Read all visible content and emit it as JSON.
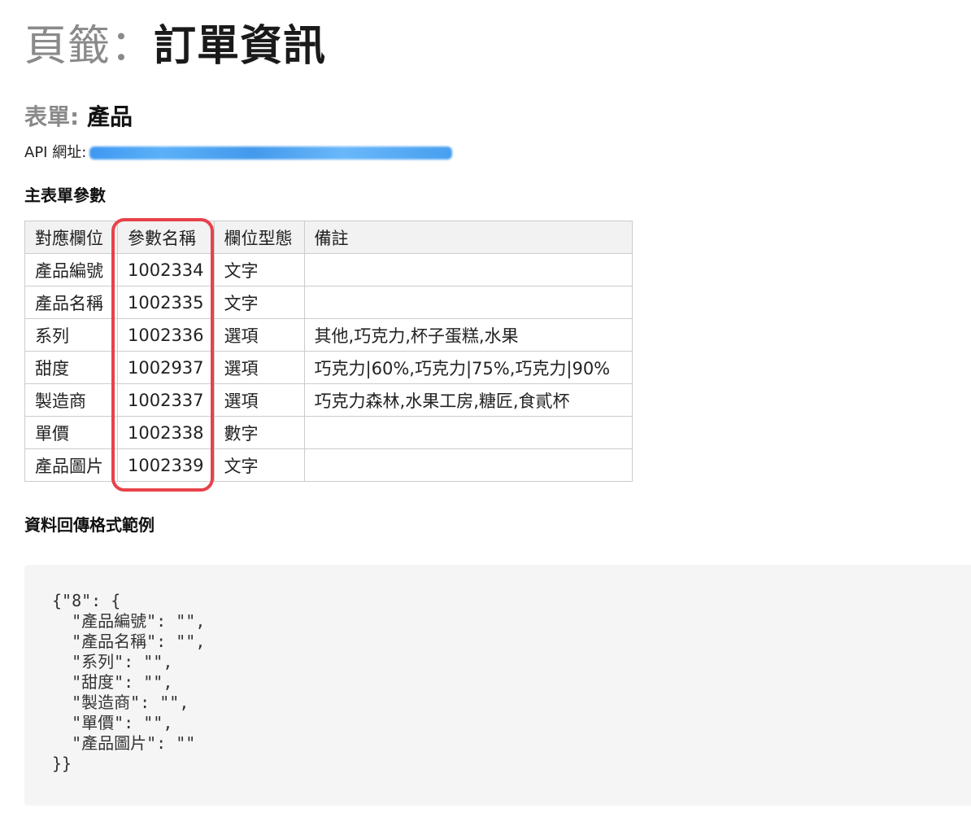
{
  "page_title": {
    "prefix": "頁籤",
    "separator": "：",
    "main": "訂單資訊"
  },
  "form_title": {
    "prefix": "表單:",
    "main": "產品"
  },
  "api": {
    "label": "API 網址:",
    "link_text": ""
  },
  "sections": {
    "main_params": "主表單參數",
    "response_example": "資料回傳格式範例"
  },
  "table": {
    "headers": [
      "對應欄位",
      "參數名稱",
      "欄位型態",
      "備註"
    ],
    "rows": [
      [
        "產品編號",
        "1002334",
        "文字",
        ""
      ],
      [
        "產品名稱",
        "1002335",
        "文字",
        ""
      ],
      [
        "系列",
        "1002336",
        "選項",
        "其他,巧克力,杯子蛋糕,水果"
      ],
      [
        "甜度",
        "1002937",
        "選項",
        "巧克力|60%,巧克力|75%,巧克力|90%"
      ],
      [
        "製造商",
        "1002337",
        "選項",
        "巧克力森林,水果工房,糖匠,食貳杯"
      ],
      [
        "單價",
        "1002338",
        "數字",
        ""
      ],
      [
        "產品圖片",
        "1002339",
        "文字",
        ""
      ]
    ]
  },
  "code_example": "{\"8\": {\n  \"產品編號\": \"\",\n  \"產品名稱\": \"\",\n  \"系列\": \"\",\n  \"甜度\": \"\",\n  \"製造商\": \"\",\n  \"單價\": \"\",\n  \"產品圖片\": \"\"\n}}",
  "colors": {
    "highlight_border": "#e8424a",
    "link_blue": "#2a8ef0",
    "code_background": "#f5f5f5",
    "header_background": "#f2f2f2"
  }
}
